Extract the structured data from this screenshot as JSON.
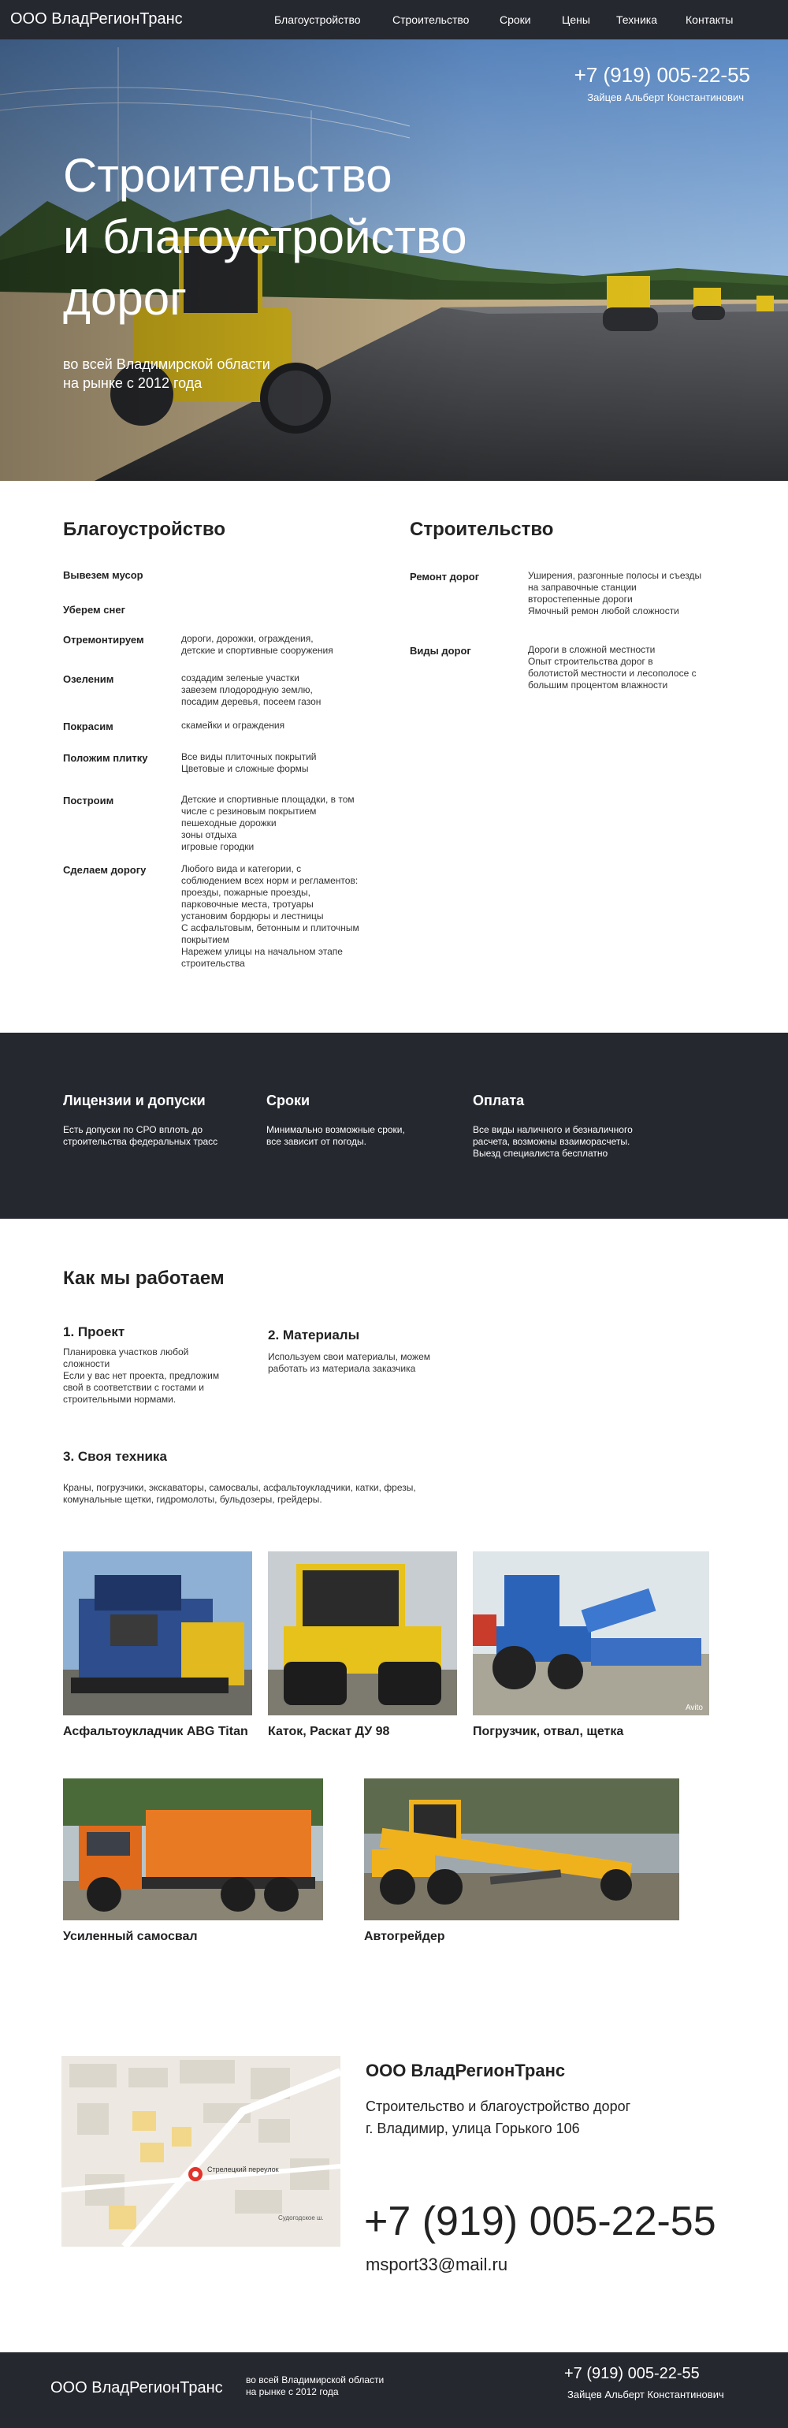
{
  "brand": "ООО ВладРегионТранс",
  "nav": [
    "Благоустройство",
    "Строительство",
    "Сроки",
    "Цены",
    "Техника",
    "Контакты"
  ],
  "hero": {
    "phone": "+7 (919) 005-22-55",
    "person": "Зайцев Альберт Константинович",
    "title_lines": [
      "Строительство",
      "и благоустройство",
      "дорог"
    ],
    "sub_lines": [
      "во всей Владимирской области",
      "на рынке с 2012 года"
    ]
  },
  "improvement": {
    "title": "Благоустройство",
    "rows": [
      {
        "label": "Вывезем мусор",
        "text": []
      },
      {
        "label": "Уберем снег",
        "text": []
      },
      {
        "label": "Отремонтируем",
        "text": [
          "дороги, дорожки, ограждения,",
          "детские и спортивные сооружения"
        ]
      },
      {
        "label": "Озеленим",
        "text": [
          "создадим зеленые участки",
          "завезем плодородную землю,",
          "посадим деревья, посеем газон"
        ]
      },
      {
        "label": "Покрасим",
        "text": [
          "скамейки и ограждения"
        ]
      },
      {
        "label": "Положим плитку",
        "text": [
          "Все виды плиточных покрытий",
          "Цветовые и сложные формы"
        ]
      },
      {
        "label": "Построим",
        "text": [
          "Детские и спортивные площадки, в том",
          "числе с резиновым покрытием",
          "пешеходные дорожки",
          "зоны отдыха",
          "игровые городки"
        ]
      },
      {
        "label": "Сделаем дорогу",
        "text": [
          "Любого вида и категории, с",
          "соблюдением всех норм и регламентов:",
          "проезды, пожарные проезды,",
          "парковочные места, тротуары",
          "установим бордюры и лестницы",
          "С асфальтовым, бетонным и плиточным",
          "покрытием",
          "Нарежем улицы на начальном этапе",
          "строительства"
        ]
      }
    ]
  },
  "construction": {
    "title": "Строительство",
    "rows": [
      {
        "label": "Ремонт дорог",
        "text": [
          "Уширения, разгонные полосы и съезды",
          "на заправочные станции",
          "второстепенные дороги",
          "Ямочный ремон любой сложности"
        ]
      },
      {
        "label": "Виды дорог",
        "text": [
          "Дороги в сложной местности",
          "Опыт строительства дорог в",
          "болотистой местности и лесополосе с",
          "большим процентом влажности"
        ]
      }
    ]
  },
  "band": [
    {
      "title": "Лицензии и допуски",
      "text": [
        "Есть допуски по СРО вплоть до",
        "строительства федеральных трасс"
      ]
    },
    {
      "title": "Сроки",
      "text": [
        "Минимально возможные сроки,",
        "все зависит от погоды."
      ]
    },
    {
      "title": "Оплата",
      "text": [
        "Все виды наличного и безналичного",
        "расчета, возможны взаиморасчеты.",
        "Выезд специалиста бесплатно"
      ]
    }
  ],
  "how": {
    "title": "Как мы работаем",
    "steps": [
      {
        "title": "1. Проект",
        "text": [
          "Планировка участков любой",
          "сложности",
          "Если у вас нет проекта, предложим",
          "свой в соответствии с гостами и",
          "строительными нормами."
        ]
      },
      {
        "title": "2. Материалы",
        "text": [
          "Используем свои материалы, можем",
          "работать из материала заказчика"
        ]
      },
      {
        "title": "3. Своя техника",
        "text": [
          "Краны, погрузчики, экскаваторы, самосвалы, асфальтоукладчики, катки, фрезы,",
          "комунальные щетки, гидромолоты, бульдозеры, грейдеры."
        ]
      }
    ]
  },
  "equipment": [
    {
      "caption": "Асфальтоукладчик ABG Titan"
    },
    {
      "caption": "Каток, Раскат ДУ 98"
    },
    {
      "caption": "Погрузчик, отвал, щетка"
    },
    {
      "caption": "Усиленный самосвал"
    },
    {
      "caption": "Автогрейдер"
    }
  ],
  "photo_watermark": "Avito",
  "map": {
    "street": "Стрелецкий переулок",
    "street2": "Судогодское ш."
  },
  "contact": {
    "company": "ООО ВладРегионТранс",
    "tagline": "Строительство и благоустройство дорог",
    "address": "г. Владимир, улица Горького 106",
    "phone": "+7 (919) 005-22-55",
    "email": "msport33@mail.ru"
  },
  "footer": {
    "brand": "ООО ВладРегионТранс",
    "sub_lines": [
      "во всей Владимирской области",
      "на рынке с 2012 года"
    ],
    "phone": "+7 (919) 005-22-55",
    "person": "Зайцев Альберт Константинович"
  }
}
